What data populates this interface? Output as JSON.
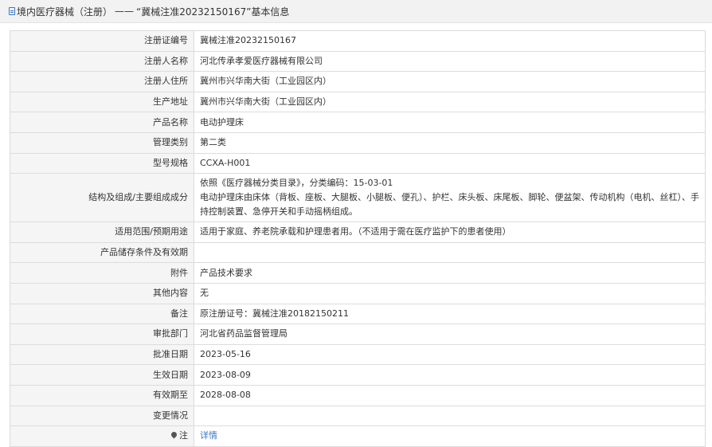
{
  "header": {
    "category": "境内医疗器械（注册）",
    "separator": "——",
    "record_title": "“冀械注准20232150167”基本信息"
  },
  "rows": [
    {
      "label": "注册证编号",
      "value": "冀械注准20232150167"
    },
    {
      "label": "注册人名称",
      "value": "河北传承孝爱医疗器械有限公司"
    },
    {
      "label": "注册人住所",
      "value": "冀州市兴华南大街（工业园区内）"
    },
    {
      "label": "生产地址",
      "value": "冀州市兴华南大街（工业园区内）"
    },
    {
      "label": "产品名称",
      "value": "电动护理床"
    },
    {
      "label": "管理类别",
      "value": "第二类"
    },
    {
      "label": "型号规格",
      "value": "CCXA-H001"
    },
    {
      "label": "结构及组成/主要组成成分",
      "line1": "依照《医疗器械分类目录》，分类编码：15-03-01",
      "line2": "电动护理床由床体（背板、座板、大腿板、小腿板、便孔）、护栏、床头板、床尾板、脚轮、便盆架、传动机构（电机、丝杠）、手持控制装置、急停开关和手动摇柄组成。"
    },
    {
      "label": "适用范围/预期用途",
      "value": "适用于家庭、养老院承载和护理患者用。（不适用于需在医疗监护下的患者使用）"
    },
    {
      "label": "产品储存条件及有效期",
      "value": ""
    },
    {
      "label": "附件",
      "value": "产品技术要求"
    },
    {
      "label": "其他内容",
      "value": "无"
    },
    {
      "label": "备注",
      "value": "原注册证号：冀械注准20182150211"
    },
    {
      "label": "审批部门",
      "value": "河北省药品监督管理局"
    },
    {
      "label": "批准日期",
      "value": "2023-05-16"
    },
    {
      "label": "生效日期",
      "value": "2023-08-09"
    },
    {
      "label": "有效期至",
      "value": "2028-08-08"
    },
    {
      "label": "变更情况",
      "value": ""
    },
    {
      "label": "注",
      "value": "详情"
    }
  ],
  "icons": {
    "title": "document-icon",
    "note": "pin-icon"
  },
  "colors": {
    "link": "#3a78c5",
    "label_bg": "#f5f5f5",
    "border": "#dcdcdc"
  }
}
